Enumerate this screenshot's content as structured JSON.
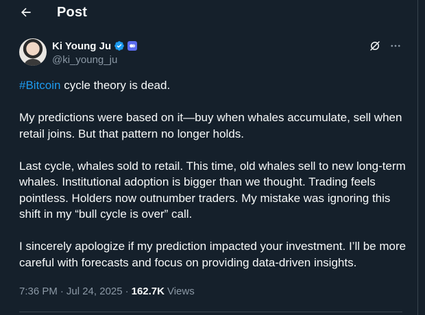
{
  "header": {
    "title": "Post",
    "back_icon": "arrow-left-icon"
  },
  "author": {
    "display_name": "Ki Young Ju",
    "handle": "@ki_young_ju",
    "verified_color": "#1d9bf0",
    "affiliate_badge_color": "#5b6cf0"
  },
  "post": {
    "hashtag": "#Bitcoin",
    "p1_rest": " cycle theory is dead.",
    "p2": "My predictions were based on it—buy when whales accumulate, sell when retail joins. But that pattern no longer holds.",
    "p3": "Last cycle, whales sold to retail. This time, old whales sell to new long-term whales. Institutional adoption is bigger than we thought. Trading feels pointless. Holders now outnumber traders. My mistake was ignoring this shift in my “bull cycle is over” call.",
    "p4": "I sincerely apologize if my prediction impacted your investment. I’ll be more careful with forecasts and focus on providing data-driven insights."
  },
  "meta": {
    "time": "7:36 PM",
    "separator": "·",
    "date": "Jul 24, 2025",
    "views_count": "162.7K",
    "views_label": "Views"
  },
  "colors": {
    "background": "#15202b",
    "text": "#f7f9f9",
    "secondary": "#8b98a5",
    "accent": "#1d9bf0"
  }
}
